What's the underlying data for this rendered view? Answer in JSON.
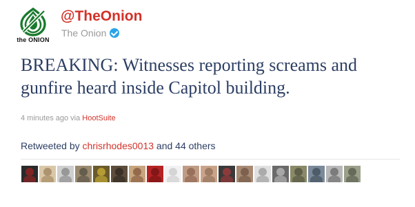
{
  "profile": {
    "logo_text": "the ONION",
    "logo_color": "#1b7a2e",
    "handle": "@TheOnion",
    "display_name": "The Onion",
    "verified_icon": "verified-badge-icon"
  },
  "tweet": {
    "text": "BREAKING: Witnesses reporting screams and gunfire heard inside Capitol building.",
    "time_ago": "4 minutes ago",
    "via_label": "via",
    "source": "HootSuite"
  },
  "retweets": {
    "prefix": "Retweeted by",
    "user": "chrisrhodes0013",
    "suffix": "and 44 others"
  },
  "colors": {
    "accent_red": "#d2322a",
    "tweet_text": "#2c3e63",
    "muted": "#999999"
  },
  "retweeter_avatars": [
    {
      "bg": "#2a2a2a",
      "fg": "#c81e1e"
    },
    {
      "bg": "#d9c7a8",
      "fg": "#8a6a3e"
    },
    {
      "bg": "#cfcfcf",
      "fg": "#6b6b6b"
    },
    {
      "bg": "#9a8a70",
      "fg": "#3d3a30"
    },
    {
      "bg": "#6b5a2a",
      "fg": "#f0d23a"
    },
    {
      "bg": "#5c4d3c",
      "fg": "#1f1a14"
    },
    {
      "bg": "#c7a57f",
      "fg": "#6b3b22"
    },
    {
      "bg": "#b52424",
      "fg": "#5a0c0c"
    },
    {
      "bg": "#f2f2f2",
      "fg": "#bdbdbd"
    },
    {
      "bg": "#bf9c86",
      "fg": "#7a4d37"
    },
    {
      "bg": "#c9a48a",
      "fg": "#7a5a44"
    },
    {
      "bg": "#3a3a3a",
      "fg": "#cf3a3a"
    },
    {
      "bg": "#a88a74",
      "fg": "#5a4030"
    },
    {
      "bg": "#e0e0e0",
      "fg": "#7f7f7f"
    },
    {
      "bg": "#6a6a6a",
      "fg": "#d8d8d8"
    },
    {
      "bg": "#8a8a6a",
      "fg": "#3c3c2a"
    },
    {
      "bg": "#7a8a9a",
      "fg": "#2a3440"
    },
    {
      "bg": "#b8b8b8",
      "fg": "#4a4a4a"
    },
    {
      "bg": "#9aa08a",
      "fg": "#3a4032"
    }
  ]
}
